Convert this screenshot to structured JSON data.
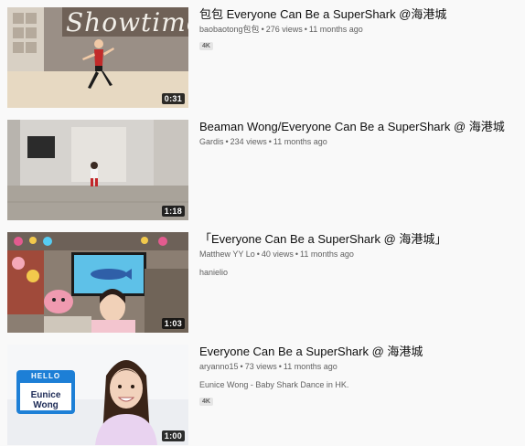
{
  "videos": [
    {
      "title": "包包 Everyone Can Be a SuperShark @海港城",
      "channel": "baobaotong包包",
      "views": "276 views",
      "age": "11 months ago",
      "badge": "4K",
      "description": "",
      "duration": "0:31",
      "thumb_text": "Showtime"
    },
    {
      "title": "Beaman Wong/Everyone Can Be a SuperShark @ 海港城",
      "channel": "Gardis",
      "views": "234 views",
      "age": "11 months ago",
      "badge": "",
      "description": "",
      "duration": "1:18"
    },
    {
      "title": "「Everyone Can Be a SuperShark @ 海港城」",
      "channel": "Matthew YY Lo",
      "views": "40 views",
      "age": "11 months ago",
      "badge": "",
      "description": "hanielio",
      "duration": "1:03"
    },
    {
      "title": "Everyone Can Be a SuperShark @ 海港城",
      "channel": "aryanno15",
      "views": "73 views",
      "age": "11 months ago",
      "badge": "4K",
      "description": "Eunice Wong - Baby Shark Dance in HK.",
      "duration": "1:00",
      "thumb_sticker_top": "HELLO",
      "thumb_sticker_name": "Eunice Wong"
    }
  ],
  "separator": "•"
}
